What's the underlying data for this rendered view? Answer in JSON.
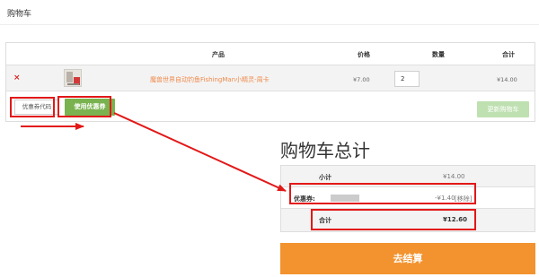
{
  "page": {
    "title": "购物车"
  },
  "cart": {
    "headers": {
      "product": "产品",
      "price": "价格",
      "quantity": "数量",
      "total": "合计"
    },
    "item": {
      "remove_icon": "close-icon",
      "remove_symbol": "×",
      "thumbnail": "product-thumbnail",
      "name": "魔兽世界自动钓鱼FishingMan小精灵-周卡",
      "price": "¥7.00",
      "quantity": "2",
      "total": "¥14.00"
    },
    "coupon": {
      "placeholder": "优惠券代码",
      "apply_label": "使用优惠券"
    },
    "update_label": "更新购物车"
  },
  "totals": {
    "title": "购物车总计",
    "subtotal": {
      "label": "小计",
      "value": "¥14.00"
    },
    "coupon": {
      "label": "优惠券:",
      "code": "",
      "amount": "-¥1.40",
      "remove_label": "[移除]"
    },
    "total": {
      "label": "合计",
      "value": "¥12.60"
    }
  },
  "checkout_label": "去结算",
  "colors": {
    "accent_orange": "#f2932f",
    "link_orange": "#f08a4b",
    "coupon_green": "#79b24f",
    "update_green_disabled": "#bfe0b1",
    "annotation_red": "#e21818",
    "remove_red": "#d72222"
  }
}
